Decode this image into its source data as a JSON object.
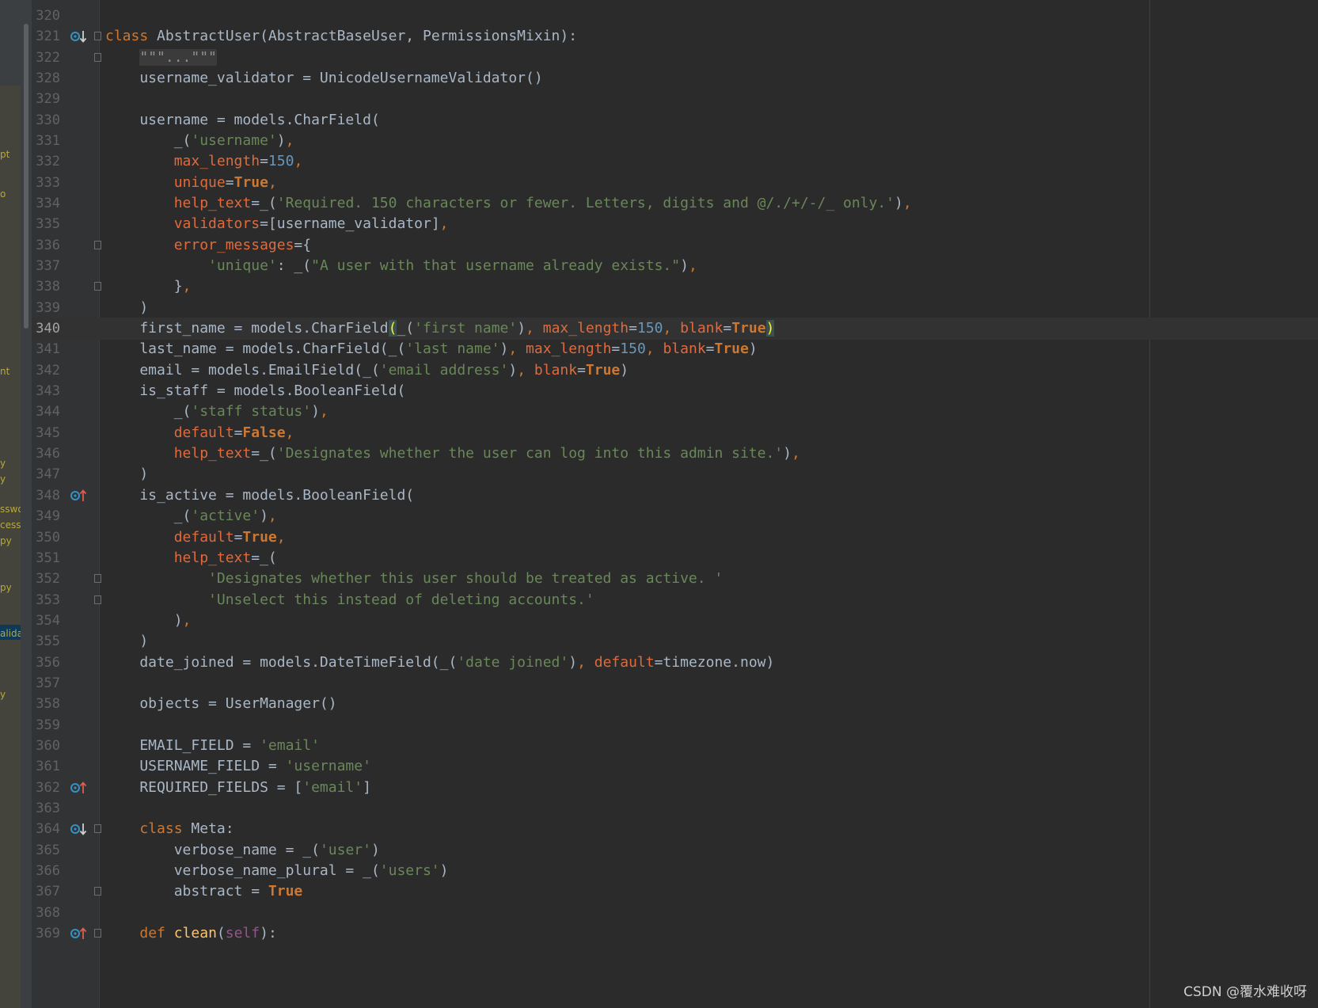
{
  "editor": {
    "lines": [
      {
        "n": "320",
        "t": []
      },
      {
        "n": "321",
        "icon": "down",
        "fold": true,
        "t": [
          [
            "kw",
            "class "
          ],
          [
            "",
            "AbstractUser(AbstractBaseUser, PermissionsMixin):"
          ]
        ]
      },
      {
        "n": "322",
        "fold": true,
        "t": [
          [
            "",
            "    "
          ],
          [
            "collapsed",
            "\"\"\"...\"\"\""
          ]
        ]
      },
      {
        "n": "328",
        "t": [
          [
            "",
            "    username_validator = UnicodeUsernameValidator()"
          ]
        ]
      },
      {
        "n": "329",
        "t": []
      },
      {
        "n": "330",
        "t": [
          [
            "",
            "    username = models.CharField("
          ]
        ]
      },
      {
        "n": "331",
        "t": [
          [
            "",
            "        _("
          ],
          [
            "str",
            "'username'"
          ],
          [
            "",
            ")"
          ],
          [
            "kw",
            ","
          ]
        ]
      },
      {
        "n": "332",
        "t": [
          [
            "",
            "        "
          ],
          [
            "param",
            "max_length"
          ],
          [
            "",
            "="
          ],
          [
            "num",
            "150"
          ],
          [
            "kw",
            ","
          ]
        ]
      },
      {
        "n": "333",
        "t": [
          [
            "",
            "        "
          ],
          [
            "param",
            "unique"
          ],
          [
            "",
            "="
          ],
          [
            "kwb",
            "True"
          ],
          [
            "kw",
            ","
          ]
        ]
      },
      {
        "n": "334",
        "t": [
          [
            "",
            "        "
          ],
          [
            "param",
            "help_text"
          ],
          [
            "",
            "=_("
          ],
          [
            "str",
            "'Required. 150 characters or fewer. Letters, digits and @/./+/-/_ only.'"
          ],
          [
            "",
            ")"
          ],
          [
            "kw",
            ","
          ]
        ]
      },
      {
        "n": "335",
        "t": [
          [
            "",
            "        "
          ],
          [
            "param",
            "validators"
          ],
          [
            "",
            "=[username_validator]"
          ],
          [
            "kw",
            ","
          ]
        ]
      },
      {
        "n": "336",
        "fold": true,
        "t": [
          [
            "",
            "        "
          ],
          [
            "param",
            "error_messages"
          ],
          [
            "",
            "={"
          ]
        ]
      },
      {
        "n": "337",
        "t": [
          [
            "",
            "            "
          ],
          [
            "str",
            "'unique'"
          ],
          [
            "",
            ": _("
          ],
          [
            "str",
            "\"A user with that username already exists.\""
          ],
          [
            "",
            ")"
          ],
          [
            "kw",
            ","
          ]
        ]
      },
      {
        "n": "338",
        "fold": true,
        "t": [
          [
            "",
            "        }"
          ],
          [
            "kw",
            ","
          ]
        ]
      },
      {
        "n": "339",
        "t": [
          [
            "",
            "    )"
          ]
        ]
      },
      {
        "n": "340",
        "current": true,
        "t": [
          [
            "",
            "    first_name = models.CharField"
          ],
          [
            "brace",
            "("
          ],
          [
            "",
            "_("
          ],
          [
            "str",
            "'first name'"
          ],
          [
            "",
            ")"
          ],
          [
            "kw",
            ", "
          ],
          [
            "param",
            "max_length"
          ],
          [
            "",
            "="
          ],
          [
            "num",
            "150"
          ],
          [
            "kw",
            ", "
          ],
          [
            "param",
            "blank"
          ],
          [
            "",
            "="
          ],
          [
            "kwb",
            "True"
          ],
          [
            "brace",
            ")"
          ]
        ]
      },
      {
        "n": "341",
        "t": [
          [
            "",
            "    last_name = models.CharField(_("
          ],
          [
            "str",
            "'last name'"
          ],
          [
            "",
            ")"
          ],
          [
            "kw",
            ", "
          ],
          [
            "param",
            "max_length"
          ],
          [
            "",
            "="
          ],
          [
            "num",
            "150"
          ],
          [
            "kw",
            ", "
          ],
          [
            "param",
            "blank"
          ],
          [
            "",
            "="
          ],
          [
            "kwb",
            "True"
          ],
          [
            "",
            ")"
          ]
        ]
      },
      {
        "n": "342",
        "t": [
          [
            "",
            "    email = models.EmailField(_("
          ],
          [
            "str",
            "'email address'"
          ],
          [
            "",
            ")"
          ],
          [
            "kw",
            ", "
          ],
          [
            "param",
            "blank"
          ],
          [
            "",
            "="
          ],
          [
            "kwb",
            "True"
          ],
          [
            "",
            ")"
          ]
        ]
      },
      {
        "n": "343",
        "t": [
          [
            "",
            "    is_staff = models.BooleanField("
          ]
        ]
      },
      {
        "n": "344",
        "t": [
          [
            "",
            "        _("
          ],
          [
            "str",
            "'staff status'"
          ],
          [
            "",
            ")"
          ],
          [
            "kw",
            ","
          ]
        ]
      },
      {
        "n": "345",
        "t": [
          [
            "",
            "        "
          ],
          [
            "param",
            "default"
          ],
          [
            "",
            "="
          ],
          [
            "kwb",
            "False"
          ],
          [
            "kw",
            ","
          ]
        ]
      },
      {
        "n": "346",
        "t": [
          [
            "",
            "        "
          ],
          [
            "param",
            "help_text"
          ],
          [
            "",
            "=_("
          ],
          [
            "str",
            "'Designates whether the user can log into this admin site.'"
          ],
          [
            "",
            ")"
          ],
          [
            "kw",
            ","
          ]
        ]
      },
      {
        "n": "347",
        "t": [
          [
            "",
            "    )"
          ]
        ]
      },
      {
        "n": "348",
        "icon": "up",
        "t": [
          [
            "",
            "    is_active = models.BooleanField("
          ]
        ]
      },
      {
        "n": "349",
        "t": [
          [
            "",
            "        _("
          ],
          [
            "str",
            "'active'"
          ],
          [
            "",
            ")"
          ],
          [
            "kw",
            ","
          ]
        ]
      },
      {
        "n": "350",
        "t": [
          [
            "",
            "        "
          ],
          [
            "param",
            "default"
          ],
          [
            "",
            "="
          ],
          [
            "kwb",
            "True"
          ],
          [
            "kw",
            ","
          ]
        ]
      },
      {
        "n": "351",
        "t": [
          [
            "",
            "        "
          ],
          [
            "param",
            "help_text"
          ],
          [
            "",
            "=_("
          ]
        ]
      },
      {
        "n": "352",
        "fold": true,
        "t": [
          [
            "",
            "            "
          ],
          [
            "str",
            "'Designates whether this user should be treated as active. '"
          ]
        ]
      },
      {
        "n": "353",
        "fold": true,
        "t": [
          [
            "",
            "            "
          ],
          [
            "str",
            "'Unselect this instead of deleting accounts.'"
          ]
        ]
      },
      {
        "n": "354",
        "t": [
          [
            "",
            "        )"
          ],
          [
            "kw",
            ","
          ]
        ]
      },
      {
        "n": "355",
        "t": [
          [
            "",
            "    )"
          ]
        ]
      },
      {
        "n": "356",
        "t": [
          [
            "",
            "    date_joined = models.DateTimeField(_("
          ],
          [
            "str",
            "'date joined'"
          ],
          [
            "",
            ")"
          ],
          [
            "kw",
            ", "
          ],
          [
            "param",
            "default"
          ],
          [
            "",
            "=timezone.now)"
          ]
        ]
      },
      {
        "n": "357",
        "t": []
      },
      {
        "n": "358",
        "t": [
          [
            "",
            "    objects = UserManager()"
          ]
        ]
      },
      {
        "n": "359",
        "t": []
      },
      {
        "n": "360",
        "t": [
          [
            "",
            "    EMAIL_FIELD = "
          ],
          [
            "str",
            "'email'"
          ]
        ]
      },
      {
        "n": "361",
        "t": [
          [
            "",
            "    USERNAME_FIELD = "
          ],
          [
            "str",
            "'username'"
          ]
        ]
      },
      {
        "n": "362",
        "icon": "up",
        "t": [
          [
            "",
            "    REQUIRED_FIELDS = ["
          ],
          [
            "str",
            "'email'"
          ],
          [
            "",
            "]"
          ]
        ]
      },
      {
        "n": "363",
        "t": []
      },
      {
        "n": "364",
        "icon": "down",
        "fold": true,
        "t": [
          [
            "",
            "    "
          ],
          [
            "kw",
            "class "
          ],
          [
            "",
            "Meta:"
          ]
        ]
      },
      {
        "n": "365",
        "t": [
          [
            "",
            "        verbose_name = _("
          ],
          [
            "str",
            "'user'"
          ],
          [
            "",
            ")"
          ]
        ]
      },
      {
        "n": "366",
        "t": [
          [
            "",
            "        verbose_name_plural = _("
          ],
          [
            "str",
            "'users'"
          ],
          [
            "",
            ")"
          ]
        ]
      },
      {
        "n": "367",
        "fold": true,
        "t": [
          [
            "",
            "        abstract = "
          ],
          [
            "kwb",
            "True"
          ]
        ]
      },
      {
        "n": "368",
        "t": []
      },
      {
        "n": "369",
        "icon": "up",
        "fold": true,
        "t": [
          [
            "",
            "    "
          ],
          [
            "kw",
            "def "
          ],
          [
            "fn",
            "clean"
          ],
          [
            "",
            "("
          ],
          [
            "self",
            "self"
          ],
          [
            "",
            "):"
          ]
        ]
      }
    ]
  },
  "sidebar": {
    "fragments": [
      "pt",
      "o",
      "nt",
      "y",
      "y",
      "sswo",
      "cess",
      "py",
      "py",
      "alida",
      "y"
    ]
  },
  "watermark": "CSDN @覆水难收呀",
  "colors": {
    "background": "#2b2b2b",
    "keyword": "#cc7832",
    "string": "#6a8759",
    "number": "#6897bb",
    "parameter": "#e06a3c",
    "function": "#ffc66d",
    "self": "#94558d",
    "text": "#a9b7c6"
  }
}
